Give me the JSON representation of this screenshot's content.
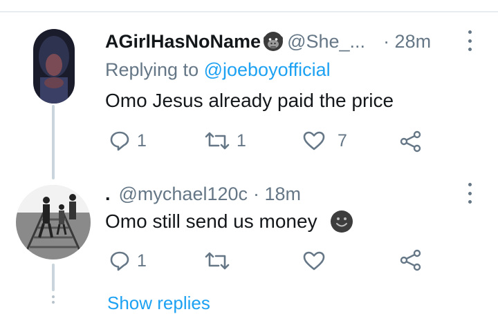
{
  "tweets": [
    {
      "display_name": "AGirlHasNoName",
      "name_emoji": "gorilla-emoji",
      "handle": "@She_...",
      "time": "· 28m",
      "replying_prefix": "Replying to ",
      "replying_to": "@joeboyofficial",
      "text": "Omo Jesus already paid the price",
      "reply_count": "1",
      "retweet_count": "1",
      "like_count": "7"
    },
    {
      "display_name": ".",
      "handle": "@mychael120c",
      "time": "· 18m",
      "text": "Omo still send us money",
      "trailing_emoji": "smiling-face-emoji",
      "reply_count": "1",
      "retweet_count": "",
      "like_count": ""
    }
  ],
  "show_replies_label": "Show replies",
  "colors": {
    "text": "#14171a",
    "muted": "#657786",
    "link": "#1da1f2",
    "thread_line": "#c9d4dc",
    "divider": "#e6ecf0"
  }
}
